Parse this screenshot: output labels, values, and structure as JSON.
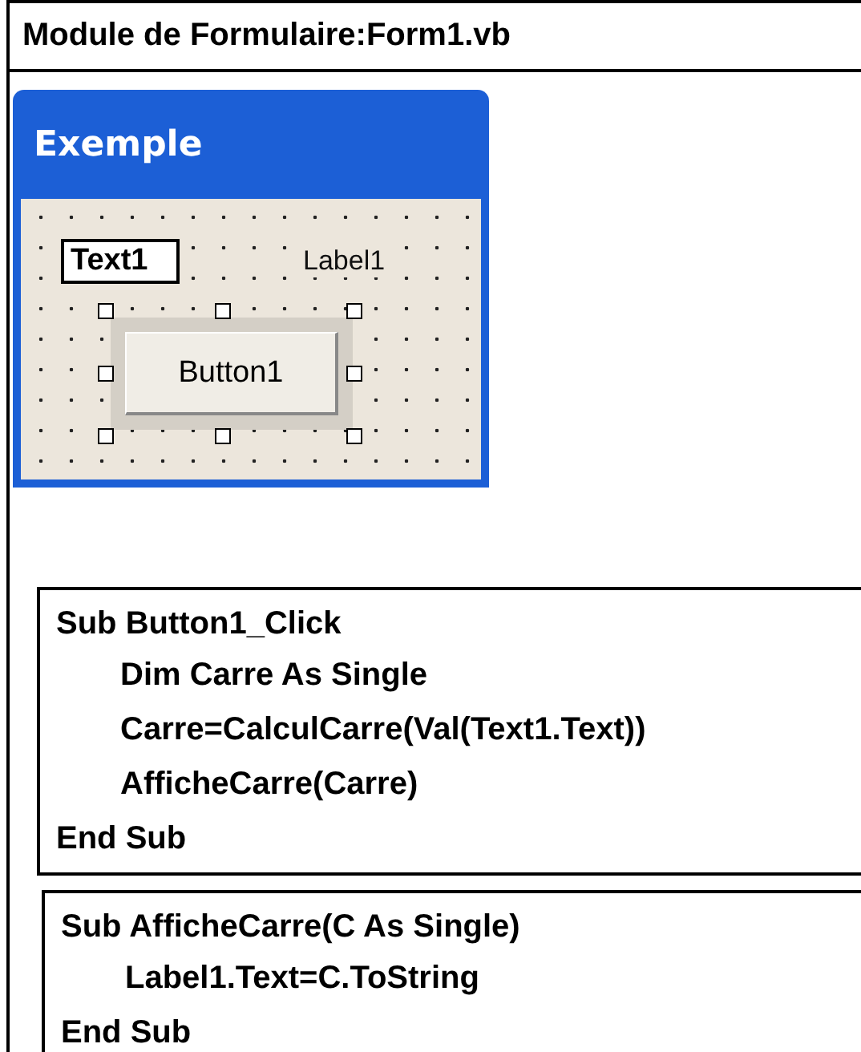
{
  "module": {
    "title": "Module de Formulaire:Form1.vb"
  },
  "form": {
    "title": "Exemple",
    "text_box": {
      "value": "Text1"
    },
    "label": {
      "text": "Label1"
    },
    "button": {
      "label": "Button1",
      "selected": true
    }
  },
  "code_blocks": [
    {
      "header": "Sub Button1_Click",
      "children": [
        "Dim Carre As Single",
        "Carre=CalculCarre(Val(Text1.Text))",
        "AfficheCarre(Carre)"
      ],
      "footer": "End Sub"
    },
    {
      "header": "Sub AfficheCarre(C As Single)",
      "children": [
        "Label1.Text=C.ToString"
      ],
      "footer": "End Sub"
    }
  ]
}
